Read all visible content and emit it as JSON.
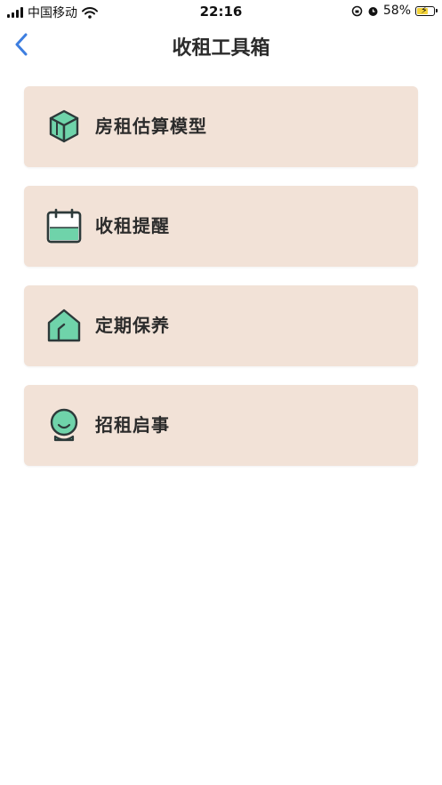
{
  "status_bar": {
    "carrier": "中国移动",
    "time": "22:16",
    "battery": "58%"
  },
  "header": {
    "title": "收租工具箱"
  },
  "menu": [
    {
      "label": "房租估算模型",
      "icon": "cube-icon"
    },
    {
      "label": "收租提醒",
      "icon": "calendar-icon"
    },
    {
      "label": "定期保养",
      "icon": "house-icon"
    },
    {
      "label": "招租启事",
      "icon": "smiley-face-icon"
    }
  ],
  "colors": {
    "card_bg": "#f2e2d7",
    "icon_fill": "#6fd3aa",
    "icon_stroke": "#2d3a3a",
    "back_arrow": "#3d7ee0"
  }
}
